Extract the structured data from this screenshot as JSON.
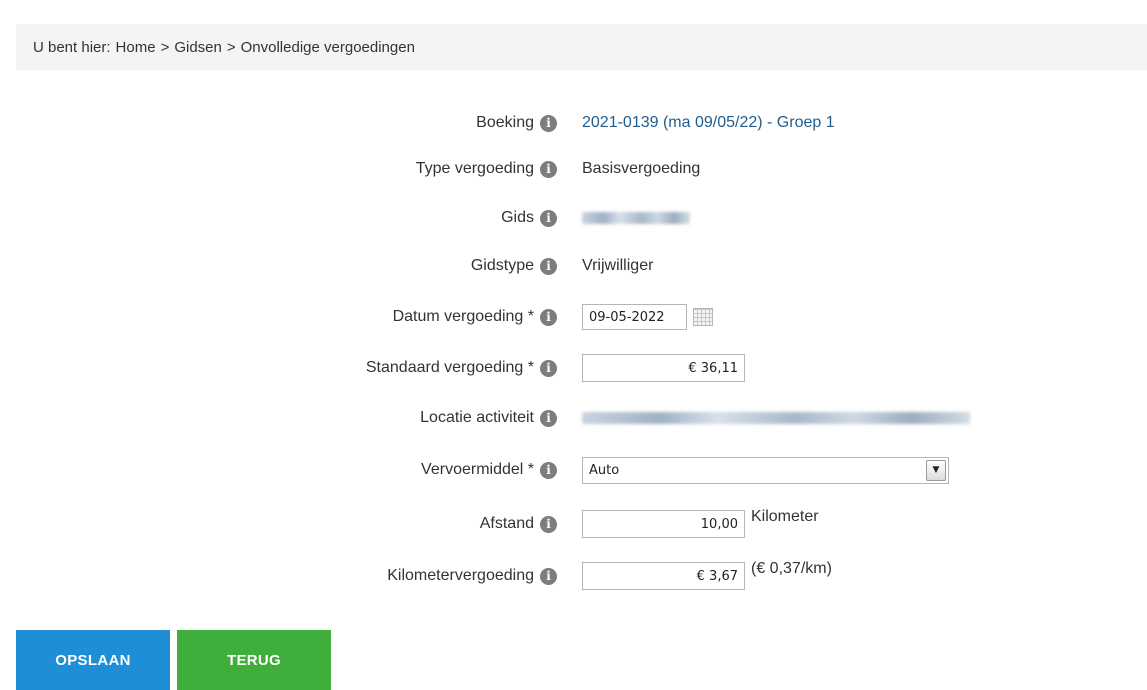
{
  "breadcrumb": {
    "prefix": "U bent hier:",
    "items": [
      "Home",
      "Gidsen",
      "Onvolledige vergoedingen"
    ],
    "separator": ">"
  },
  "form": {
    "boeking": {
      "label": "Boeking",
      "value": "2021-0139 (ma 09/05/22) - Groep 1"
    },
    "type_vergoeding": {
      "label": "Type vergoeding",
      "value": "Basisvergoeding"
    },
    "gids": {
      "label": "Gids"
    },
    "gidstype": {
      "label": "Gidstype",
      "value": "Vrijwilliger"
    },
    "datum_vergoeding": {
      "label": "Datum vergoeding *",
      "value": "09-05-2022"
    },
    "standaard_vergoeding": {
      "label": "Standaard vergoeding *",
      "value": "€ 36,11"
    },
    "locatie_activiteit": {
      "label": "Locatie activiteit"
    },
    "vervoermiddel": {
      "label": "Vervoermiddel *",
      "value": "Auto"
    },
    "afstand": {
      "label": "Afstand",
      "value": "10,00",
      "unit": "Kilometer"
    },
    "kilometervergoeding": {
      "label": "Kilometervergoeding",
      "value": "€ 3,67",
      "rate": "(€ 0,37/km)"
    }
  },
  "buttons": {
    "save": "OPSLAAN",
    "back": "TERUG"
  },
  "colors": {
    "save": "#1e8fd6",
    "back": "#3fae3a",
    "link": "#1f5d8e"
  },
  "icons": {
    "info": "info-circle-icon",
    "calendar": "calendar-icon",
    "dropdown": "chevron-down-icon"
  }
}
